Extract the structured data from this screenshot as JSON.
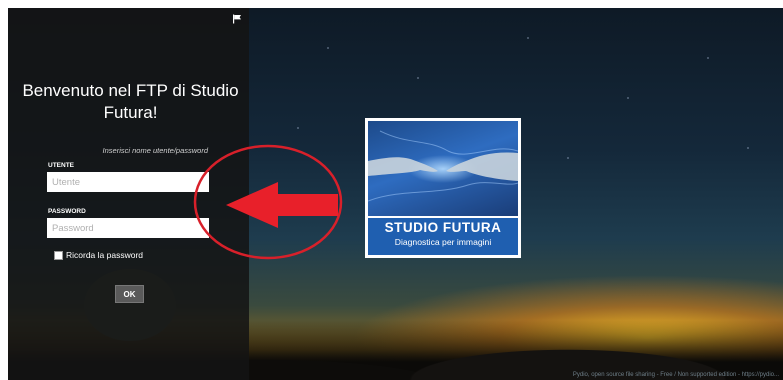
{
  "login": {
    "welcome_title": "Benvenuto nel FTP di Studio Futura!",
    "hint": "Inserisci nome utente/password",
    "username_label": "UTENTE",
    "username_placeholder": "Utente",
    "password_label": "PASSWORD",
    "password_placeholder": "Password",
    "remember_label": "Ricorda la password",
    "submit_label": "OK"
  },
  "logo": {
    "line1": "STUDIO FUTURA",
    "line2": "Diagnostica per immagini"
  },
  "footer": {
    "text": "Pydio, open source file sharing - Free / Non supported edition - https://pydio..."
  },
  "colors": {
    "arrow": "#e8202a",
    "circle": "#d8202a",
    "logo_blue": "#1f5fb0"
  },
  "icons": {
    "language": "flag-icon"
  }
}
